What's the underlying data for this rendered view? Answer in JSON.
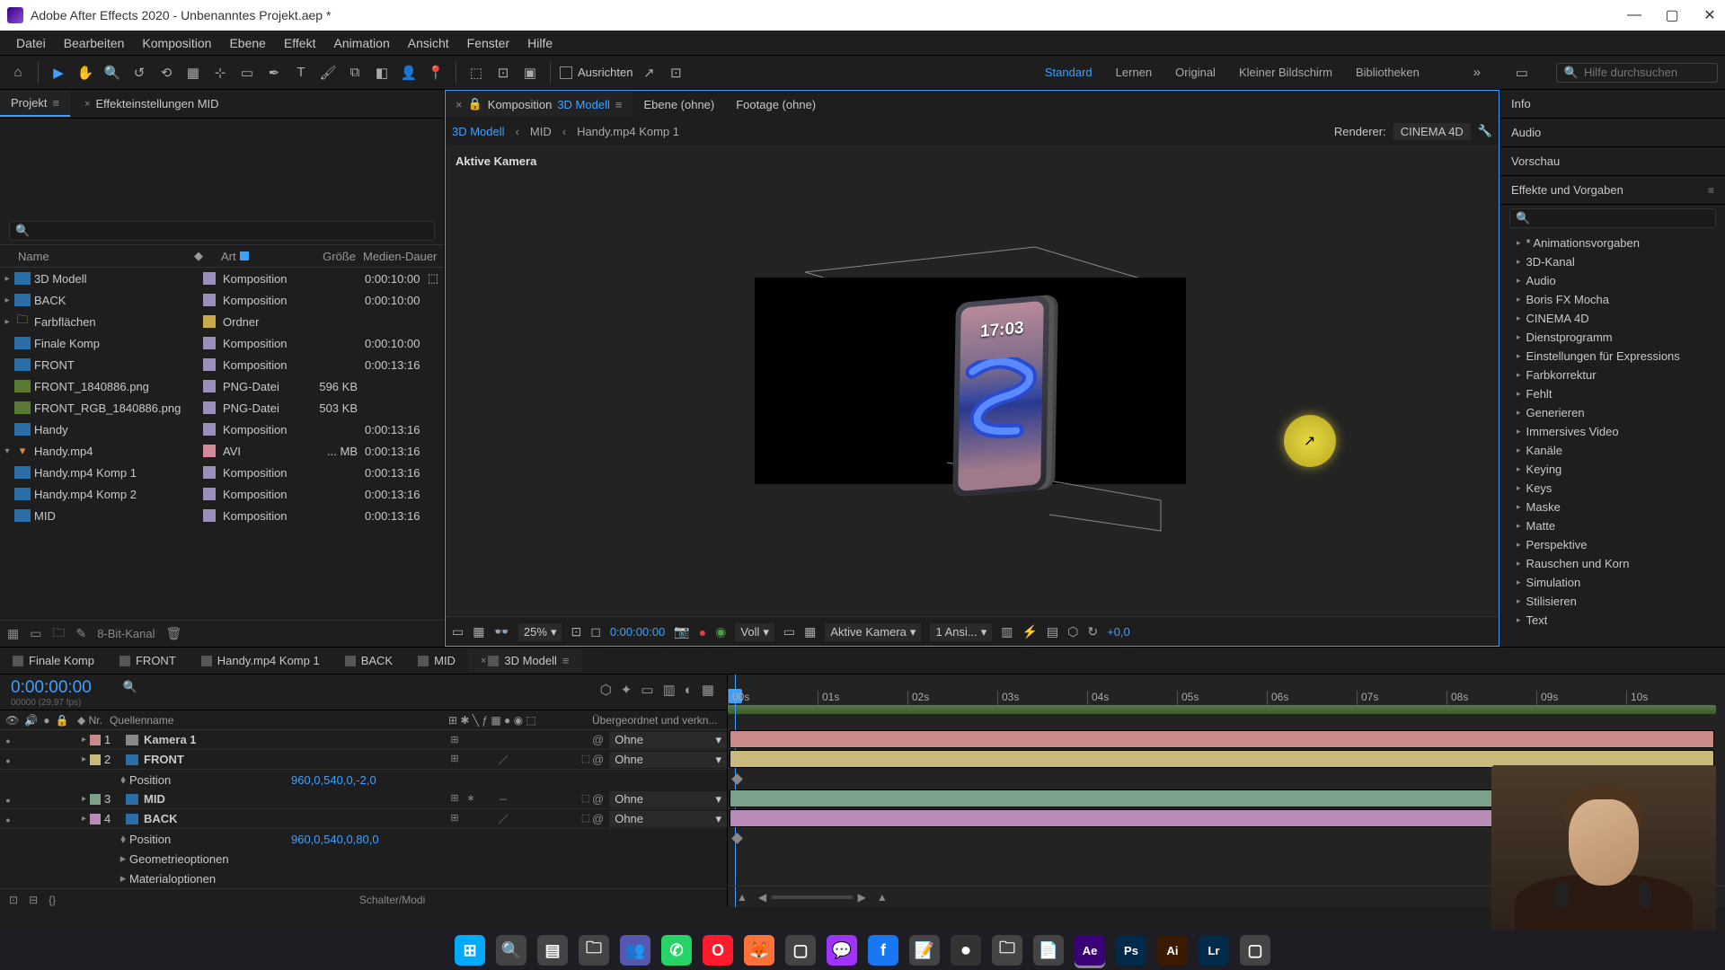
{
  "titlebar": {
    "app_icon_name": "ae-app-icon",
    "title": "Adobe After Effects 2020 - Unbenanntes Projekt.aep *"
  },
  "menu": [
    "Datei",
    "Bearbeiten",
    "Komposition",
    "Ebene",
    "Effekt",
    "Animation",
    "Ansicht",
    "Fenster",
    "Hilfe"
  ],
  "toolbar": {
    "align_label": "Ausrichten",
    "search_placeholder": "Hilfe durchsuchen"
  },
  "workspaces": {
    "items": [
      "Standard",
      "Lernen",
      "Original",
      "Kleiner Bildschirm",
      "Bibliotheken"
    ],
    "active": "Standard"
  },
  "project_panel": {
    "tab_project": "Projekt",
    "tab_effect_controls": "Effekteinstellungen MID",
    "cols": {
      "name": "Name",
      "art": "Art",
      "size": "Größe",
      "dur": "Medien-Dauer"
    },
    "rows": [
      {
        "twisty": "▸",
        "icon": "comp",
        "name": "3D Modell",
        "label": "lav",
        "art": "Komposition",
        "size": "",
        "dur": "0:00:10:00",
        "extra": true
      },
      {
        "twisty": "▸",
        "icon": "comp",
        "name": "BACK",
        "label": "lav",
        "art": "Komposition",
        "size": "",
        "dur": "0:00:10:00"
      },
      {
        "twisty": "▸",
        "icon": "folder",
        "name": "Farbflächen",
        "label": "yellow",
        "art": "Ordner",
        "size": "",
        "dur": ""
      },
      {
        "twisty": "",
        "icon": "comp",
        "name": "Finale Komp",
        "label": "lav",
        "art": "Komposition",
        "size": "",
        "dur": "0:00:10:00"
      },
      {
        "twisty": "",
        "icon": "comp",
        "name": "FRONT",
        "label": "lav",
        "art": "Komposition",
        "size": "",
        "dur": "0:00:13:16"
      },
      {
        "twisty": "",
        "icon": "png",
        "name": "FRONT_1840886.png",
        "label": "lav",
        "art": "PNG-Datei",
        "size": "596 KB",
        "dur": ""
      },
      {
        "twisty": "",
        "icon": "png",
        "name": "FRONT_RGB_1840886.png",
        "label": "lav",
        "art": "PNG-Datei",
        "size": "503 KB",
        "dur": ""
      },
      {
        "twisty": "",
        "icon": "comp",
        "name": "Handy",
        "label": "lav",
        "art": "Komposition",
        "size": "",
        "dur": "0:00:13:16"
      },
      {
        "twisty": "▾",
        "icon": "avi",
        "name": "Handy.mp4",
        "label": "pink",
        "art": "AVI",
        "size": "... MB",
        "dur": "0:00:13:16"
      },
      {
        "twisty": "",
        "icon": "comp",
        "name": "Handy.mp4 Komp 1",
        "label": "lav",
        "art": "Komposition",
        "size": "",
        "dur": "0:00:13:16"
      },
      {
        "twisty": "",
        "icon": "comp",
        "name": "Handy.mp4 Komp 2",
        "label": "lav",
        "art": "Komposition",
        "size": "",
        "dur": "0:00:13:16"
      },
      {
        "twisty": "",
        "icon": "comp",
        "name": "MID",
        "label": "lav",
        "art": "Komposition",
        "size": "",
        "dur": "0:00:13:16"
      }
    ],
    "footer_bit": "8-Bit-Kanal"
  },
  "comp_panel": {
    "tab_prefix": "Komposition",
    "tab_name": "3D Modell",
    "tab_layer": "Ebene (ohne)",
    "tab_footage": "Footage (ohne)",
    "breadcrumbs": [
      "3D Modell",
      "MID",
      "Handy.mp4 Komp 1"
    ],
    "renderer_label": "Renderer:",
    "renderer_value": "CINEMA 4D",
    "active_camera": "Aktive Kamera",
    "phone_clock": "17:03",
    "footer": {
      "zoom": "25%",
      "time": "0:00:00:00",
      "res": "Voll",
      "camera": "Aktive Kamera",
      "views": "1 Ansi...",
      "exposure": "+0,0"
    }
  },
  "right_panels": {
    "info": "Info",
    "audio": "Audio",
    "preview": "Vorschau",
    "effects_title": "Effekte und Vorgaben",
    "effects": [
      "* Animationsvorgaben",
      "3D-Kanal",
      "Audio",
      "Boris FX Mocha",
      "CINEMA 4D",
      "Dienstprogramm",
      "Einstellungen für Expressions",
      "Farbkorrektur",
      "Fehlt",
      "Generieren",
      "Immersives Video",
      "Kanäle",
      "Keying",
      "Keys",
      "Maske",
      "Matte",
      "Perspektive",
      "Rauschen und Korn",
      "Simulation",
      "Stilisieren",
      "Text"
    ]
  },
  "timeline": {
    "tabs": [
      "Finale Komp",
      "FRONT",
      "Handy.mp4 Komp 1",
      "BACK",
      "MID",
      "3D Modell"
    ],
    "active_tab": "3D Modell",
    "timecode": "0:00:00:00",
    "frame_info": "00000 (29,97 fps)",
    "ticks": [
      "00s",
      "01s",
      "02s",
      "03s",
      "04s",
      "05s",
      "06s",
      "07s",
      "08s",
      "09s",
      "10s"
    ],
    "cols": {
      "nr": "Nr.",
      "name": "Quellenname",
      "parent": "Übergeordnet und verkn..."
    },
    "layers": [
      {
        "vis": true,
        "nr": "1",
        "color": "#c98a8a",
        "icon": "cam",
        "name": "Kamera 1",
        "sw": [
          "⊞"
        ],
        "parent": "Ohne",
        "bar": "#c98a8a"
      },
      {
        "vis": true,
        "nr": "2",
        "color": "#c9b97a",
        "icon": "comp",
        "name": "FRONT",
        "sw": [
          "⊞",
          "",
          "",
          "／"
        ],
        "has3d": true,
        "parent": "Ohne",
        "bar": "#c9b97a",
        "props": [
          {
            "name": "Position",
            "value": "960,0,540,0,-2,0",
            "kf": true
          }
        ]
      },
      {
        "vis": true,
        "nr": "3",
        "color": "#7aa28a",
        "icon": "comp",
        "name": "MID",
        "sw": [
          "⊞",
          "∗",
          "",
          "－"
        ],
        "has3d": true,
        "parent": "Ohne",
        "bar": "#7aa28a"
      },
      {
        "vis": true,
        "nr": "4",
        "color": "#b88ab8",
        "icon": "comp",
        "name": "BACK",
        "sw": [
          "⊞",
          "",
          "",
          "／"
        ],
        "has3d": true,
        "parent": "Ohne",
        "bar": "#b88ab8",
        "props": [
          {
            "name": "Position",
            "value": "960,0,540,0,80,0",
            "kf": true
          },
          {
            "name": "Geometrieoptionen",
            "value": "",
            "twisty": true
          },
          {
            "name": "Materialoptionen",
            "value": "",
            "twisty": true
          }
        ]
      }
    ],
    "footer_mode": "Schalter/Modi"
  },
  "taskbar": {
    "icons": [
      "windows",
      "search",
      "tasks",
      "explorer",
      "teams",
      "whatsapp",
      "opera",
      "firefox",
      "app1",
      "messenger",
      "facebook",
      "notes",
      "obs",
      "folder",
      "editor",
      "ae",
      "ps",
      "ai",
      "lr",
      "app2"
    ]
  }
}
